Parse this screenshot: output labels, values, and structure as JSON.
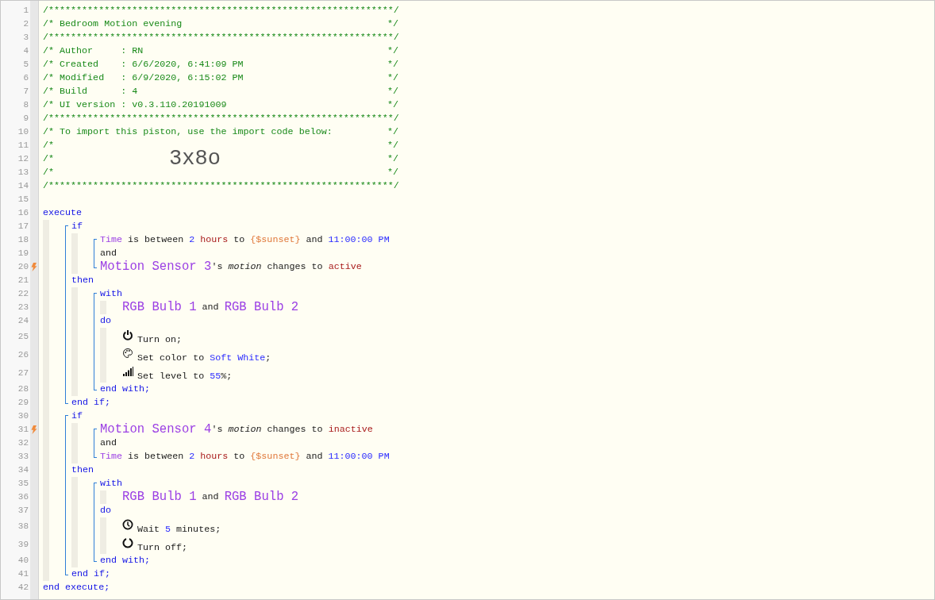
{
  "code": [
    {
      "kind": "line",
      "number": "1",
      "trigger": false,
      "tokens": [
        {
          "kind": "comment",
          "text": "/**************************************************************/"
        }
      ]
    },
    {
      "kind": "line",
      "number": "2",
      "trigger": false,
      "tokens": [
        {
          "kind": "comment",
          "text": "/* Bedroom Motion evening"
        },
        {
          "kind": "comment-end",
          "text": "*/"
        }
      ]
    },
    {
      "kind": "line",
      "number": "3",
      "trigger": false,
      "tokens": [
        {
          "kind": "comment",
          "text": "/**************************************************************/"
        }
      ]
    },
    {
      "kind": "line",
      "number": "4",
      "trigger": false,
      "tokens": [
        {
          "kind": "comment",
          "text": "/* Author     : RN"
        },
        {
          "kind": "comment-end",
          "text": "*/"
        }
      ]
    },
    {
      "kind": "line",
      "number": "5",
      "trigger": false,
      "tokens": [
        {
          "kind": "comment",
          "text": "/* Created    : 6/6/2020, 6:41:09 PM"
        },
        {
          "kind": "comment-end",
          "text": "*/"
        }
      ]
    },
    {
      "kind": "line",
      "number": "6",
      "trigger": false,
      "tokens": [
        {
          "kind": "comment",
          "text": "/* Modified   : 6/9/2020, 6:15:02 PM"
        },
        {
          "kind": "comment-end",
          "text": "*/"
        }
      ]
    },
    {
      "kind": "line",
      "number": "7",
      "trigger": false,
      "tokens": [
        {
          "kind": "comment",
          "text": "/* Build      : 4"
        },
        {
          "kind": "comment-end",
          "text": "*/"
        }
      ]
    },
    {
      "kind": "line",
      "number": "8",
      "trigger": false,
      "tokens": [
        {
          "kind": "comment",
          "text": "/* UI version : v0.3.110.20191009"
        },
        {
          "kind": "comment-end",
          "text": "*/"
        }
      ]
    },
    {
      "kind": "line",
      "number": "9",
      "trigger": false,
      "tokens": [
        {
          "kind": "comment",
          "text": "/**************************************************************/"
        }
      ]
    },
    {
      "kind": "line",
      "number": "10",
      "trigger": false,
      "tokens": [
        {
          "kind": "comment",
          "text": "/* To import this piston, use the import code below:"
        },
        {
          "kind": "comment-end",
          "text": "*/"
        }
      ]
    },
    {
      "kind": "line",
      "number": "11",
      "trigger": false,
      "tokens": [
        {
          "kind": "comment",
          "text": "/*"
        },
        {
          "kind": "comment-end",
          "text": "*/"
        }
      ]
    },
    {
      "kind": "line",
      "number": "12",
      "trigger": false,
      "tokens": [
        {
          "kind": "comment",
          "text": "/*"
        },
        {
          "kind": "import-code",
          "text": "3x8o"
        },
        {
          "kind": "comment-end",
          "text": "*/"
        }
      ]
    },
    {
      "kind": "line",
      "number": "13",
      "trigger": false,
      "tokens": [
        {
          "kind": "comment",
          "text": "/*"
        },
        {
          "kind": "comment-end",
          "text": "*/"
        }
      ]
    },
    {
      "kind": "line",
      "number": "14",
      "trigger": false,
      "tokens": [
        {
          "kind": "comment",
          "text": "/**************************************************************/"
        }
      ]
    },
    {
      "kind": "line",
      "number": "15",
      "trigger": false
    },
    {
      "kind": "line",
      "number": "16",
      "trigger": false,
      "tokens": [
        {
          "kind": "keyword",
          "text": "execute"
        }
      ]
    },
    {
      "kind": "body",
      "children": [
        {
          "kind": "bracket",
          "children": [
            {
              "kind": "line",
              "number": "17",
              "trigger": false,
              "tokens": [
                {
                  "kind": "keyword",
                  "text": "if"
                }
              ]
            },
            {
              "kind": "body",
              "children": [
                {
                  "kind": "bracket",
                  "children": [
                    {
                      "kind": "line",
                      "number": "18",
                      "trigger": false,
                      "tokens": [
                        {
                          "kind": "attribute",
                          "text": "Time"
                        },
                        {
                          "kind": "text",
                          "text": "is between"
                        },
                        {
                          "kind": "value",
                          "text": "2"
                        },
                        {
                          "kind": "unit",
                          "text": "hours"
                        },
                        {
                          "kind": "text",
                          "text": "to"
                        },
                        {
                          "kind": "variable",
                          "text": "{$sunset}"
                        },
                        {
                          "kind": "text",
                          "text": "and"
                        },
                        {
                          "kind": "value",
                          "text": "11:00:00 PM"
                        }
                      ]
                    },
                    {
                      "kind": "line",
                      "number": "19",
                      "trigger": false,
                      "tokens": [
                        {
                          "kind": "text",
                          "text": "and"
                        }
                      ]
                    },
                    {
                      "kind": "line",
                      "number": "20",
                      "trigger": true,
                      "tokens": [
                        {
                          "kind": "device",
                          "text": "Motion Sensor 3"
                        },
                        {
                          "kind": "text",
                          "text": "'s",
                          "attached": true
                        },
                        {
                          "kind": "property",
                          "text": "motion"
                        },
                        {
                          "kind": "text",
                          "text": "changes to"
                        },
                        {
                          "kind": "unit",
                          "text": "active"
                        }
                      ]
                    }
                  ]
                }
              ]
            },
            {
              "kind": "line",
              "number": "21",
              "trigger": false,
              "tokens": [
                {
                  "kind": "keyword",
                  "text": "then"
                }
              ]
            },
            {
              "kind": "body",
              "children": [
                {
                  "kind": "bracket",
                  "children": [
                    {
                      "kind": "line",
                      "number": "22",
                      "trigger": false,
                      "tokens": [
                        {
                          "kind": "keyword",
                          "text": "with"
                        }
                      ]
                    },
                    {
                      "kind": "body",
                      "children": [
                        {
                          "kind": "line",
                          "number": "23",
                          "trigger": false,
                          "tokens": [
                            {
                              "kind": "device",
                              "text": "RGB Bulb 1"
                            },
                            {
                              "kind": "text",
                              "text": "and"
                            },
                            {
                              "kind": "device",
                              "text": "RGB Bulb 2"
                            }
                          ]
                        }
                      ]
                    },
                    {
                      "kind": "line",
                      "number": "24",
                      "trigger": false,
                      "tokens": [
                        {
                          "kind": "keyword",
                          "text": "do"
                        }
                      ]
                    },
                    {
                      "kind": "body",
                      "children": [
                        {
                          "kind": "turn-on",
                          "number": "25",
                          "trigger": false,
                          "tokens": [
                            {
                              "kind": "text",
                              "text": "Turn on;"
                            }
                          ]
                        },
                        {
                          "kind": "set-color",
                          "number": "26",
                          "trigger": false,
                          "tokens": [
                            {
                              "kind": "text",
                              "text": "Set color to"
                            },
                            {
                              "kind": "value",
                              "text": "Soft White"
                            },
                            {
                              "kind": "text",
                              "text": ";",
                              "attached": true
                            }
                          ]
                        },
                        {
                          "kind": "set-level",
                          "number": "27",
                          "trigger": false,
                          "tokens": [
                            {
                              "kind": "text",
                              "text": "Set level to"
                            },
                            {
                              "kind": "value",
                              "text": "55"
                            },
                            {
                              "kind": "text",
                              "text": "%;",
                              "attached": true
                            }
                          ]
                        }
                      ]
                    },
                    {
                      "kind": "line",
                      "number": "28",
                      "trigger": false,
                      "tokens": [
                        {
                          "kind": "keyword",
                          "text": "end with;"
                        }
                      ]
                    }
                  ]
                }
              ]
            },
            {
              "kind": "line",
              "number": "29",
              "trigger": false,
              "tokens": [
                {
                  "kind": "keyword",
                  "text": "end if;"
                }
              ]
            }
          ]
        },
        {
          "kind": "bracket",
          "children": [
            {
              "kind": "line",
              "number": "30",
              "trigger": false,
              "tokens": [
                {
                  "kind": "keyword",
                  "text": "if"
                }
              ]
            },
            {
              "kind": "body",
              "children": [
                {
                  "kind": "bracket",
                  "children": [
                    {
                      "kind": "line",
                      "number": "31",
                      "trigger": true,
                      "tokens": [
                        {
                          "kind": "device",
                          "text": "Motion Sensor 4"
                        },
                        {
                          "kind": "text",
                          "text": "'s",
                          "attached": true
                        },
                        {
                          "kind": "property",
                          "text": "motion"
                        },
                        {
                          "kind": "text",
                          "text": "changes to"
                        },
                        {
                          "kind": "unit",
                          "text": "inactive"
                        }
                      ]
                    },
                    {
                      "kind": "line",
                      "number": "32",
                      "trigger": false,
                      "tokens": [
                        {
                          "kind": "text",
                          "text": "and"
                        }
                      ]
                    },
                    {
                      "kind": "line",
                      "number": "33",
                      "trigger": false,
                      "tokens": [
                        {
                          "kind": "attribute",
                          "text": "Time"
                        },
                        {
                          "kind": "text",
                          "text": "is between"
                        },
                        {
                          "kind": "value",
                          "text": "2"
                        },
                        {
                          "kind": "unit",
                          "text": "hours"
                        },
                        {
                          "kind": "text",
                          "text": "to"
                        },
                        {
                          "kind": "variable",
                          "text": "{$sunset}"
                        },
                        {
                          "kind": "text",
                          "text": "and"
                        },
                        {
                          "kind": "value",
                          "text": "11:00:00 PM"
                        }
                      ]
                    }
                  ]
                }
              ]
            },
            {
              "kind": "line",
              "number": "34",
              "trigger": false,
              "tokens": [
                {
                  "kind": "keyword",
                  "text": "then"
                }
              ]
            },
            {
              "kind": "body",
              "children": [
                {
                  "kind": "bracket",
                  "children": [
                    {
                      "kind": "line",
                      "number": "35",
                      "trigger": false,
                      "tokens": [
                        {
                          "kind": "keyword",
                          "text": "with"
                        }
                      ]
                    },
                    {
                      "kind": "body",
                      "children": [
                        {
                          "kind": "line",
                          "number": "36",
                          "trigger": false,
                          "tokens": [
                            {
                              "kind": "device",
                              "text": "RGB Bulb 1"
                            },
                            {
                              "kind": "text",
                              "text": "and"
                            },
                            {
                              "kind": "device",
                              "text": "RGB Bulb 2"
                            }
                          ]
                        }
                      ]
                    },
                    {
                      "kind": "line",
                      "number": "37",
                      "trigger": false,
                      "tokens": [
                        {
                          "kind": "keyword",
                          "text": "do"
                        }
                      ]
                    },
                    {
                      "kind": "body",
                      "children": [
                        {
                          "kind": "wait",
                          "number": "38",
                          "trigger": false,
                          "tokens": [
                            {
                              "kind": "text",
                              "text": "Wait"
                            },
                            {
                              "kind": "value",
                              "text": "5"
                            },
                            {
                              "kind": "text",
                              "text": "minutes;"
                            }
                          ]
                        },
                        {
                          "kind": "turn-off",
                          "number": "39",
                          "trigger": false,
                          "tokens": [
                            {
                              "kind": "text",
                              "text": "Turn off;"
                            }
                          ]
                        }
                      ]
                    },
                    {
                      "kind": "line",
                      "number": "40",
                      "trigger": false,
                      "tokens": [
                        {
                          "kind": "keyword",
                          "text": "end with;"
                        }
                      ]
                    }
                  ]
                }
              ]
            },
            {
              "kind": "line",
              "number": "41",
              "trigger": false,
              "tokens": [
                {
                  "kind": "keyword",
                  "text": "end if;"
                }
              ]
            }
          ]
        }
      ]
    },
    {
      "kind": "line",
      "number": "42",
      "trigger": false,
      "tokens": [
        {
          "kind": "keyword",
          "text": "end execute;"
        }
      ]
    }
  ]
}
